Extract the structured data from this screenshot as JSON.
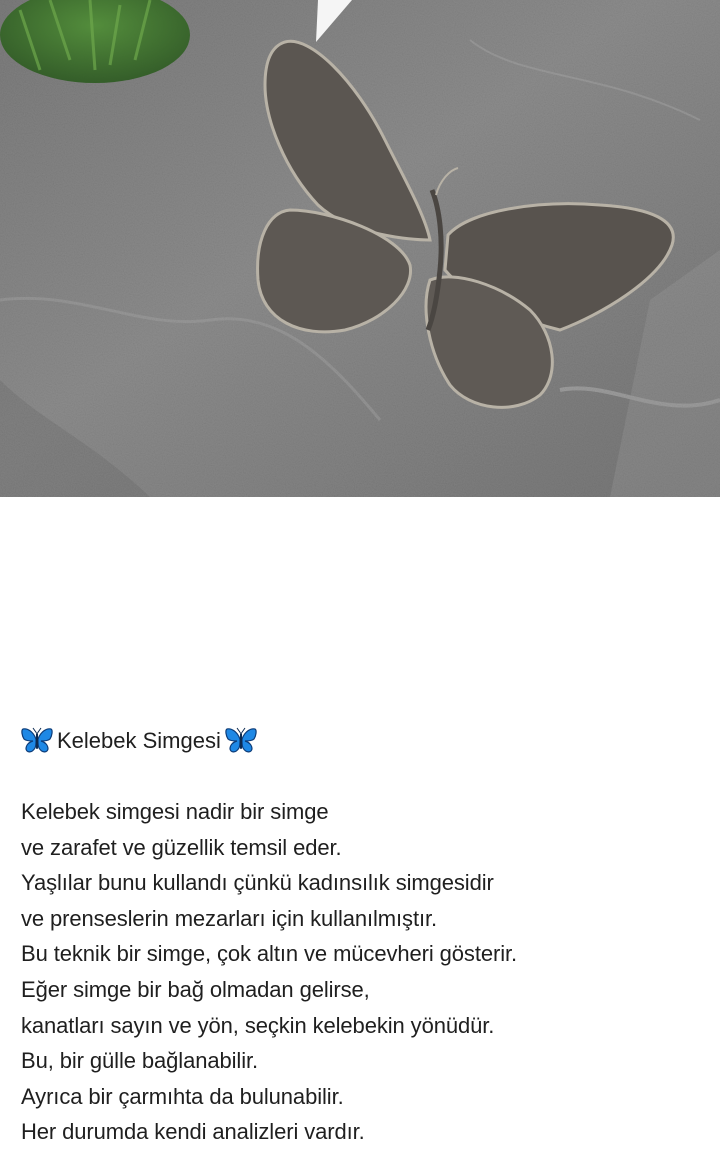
{
  "photo": {
    "subject_icon": "butterfly-icon",
    "colors": {
      "stone": "#8a8a8a",
      "stone_dark": "#5d5d5d",
      "butterfly": "#5b5651",
      "butterfly_outline": "#b8b2a6",
      "grass": "#3f7a2c"
    }
  },
  "post": {
    "title": "Kelebek Simgesi",
    "title_emoji": "blue-butterfly-emoji",
    "emoji_color": "#1e88e5",
    "lines": [
      "Kelebek simgesi nadir bir simge",
      "ve zarafet ve güzellik temsil eder.",
      "Yaşlılar bunu kullandı çünkü kadınsılık simgesidir",
      "ve prenseslerin mezarları için kullanılmıştır.",
      "Bu teknik bir simge, çok altın ve mücevheri gösterir.",
      "Eğer simge bir bağ olmadan gelirse,",
      "kanatları sayın ve yön, seçkin kelebekin yönüdür.",
      "Bu, bir gülle bağlanabilir.",
      "Ayrıca bir çarmıhta da bulunabilir.",
      "Her durumda kendi analizleri vardır."
    ]
  }
}
